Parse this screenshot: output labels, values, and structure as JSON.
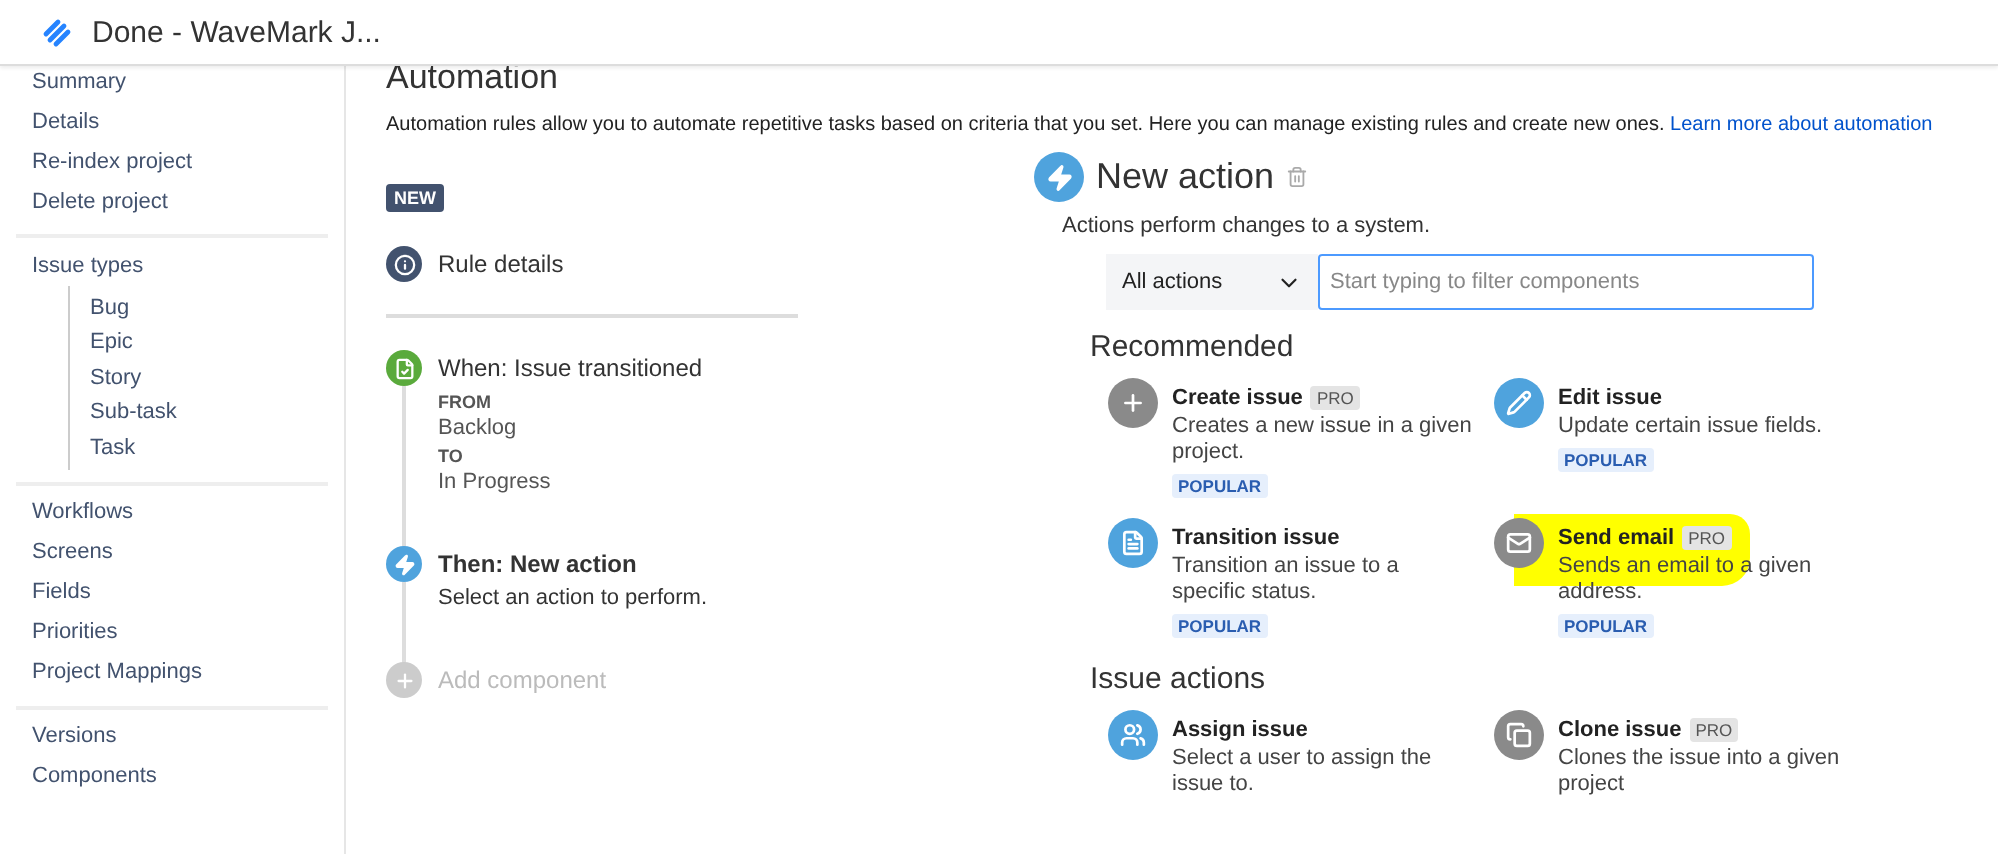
{
  "header": {
    "title": "Done - WaveMark J..."
  },
  "sidebar": {
    "groups": [
      {
        "items": [
          {
            "label": "Summary"
          },
          {
            "label": "Details"
          },
          {
            "label": "Re-index project"
          },
          {
            "label": "Delete project"
          }
        ]
      },
      {
        "items": [
          {
            "label": "Issue types",
            "children": [
              {
                "label": "Bug"
              },
              {
                "label": "Epic"
              },
              {
                "label": "Story"
              },
              {
                "label": "Sub-task"
              },
              {
                "label": "Task"
              }
            ]
          }
        ]
      },
      {
        "items": [
          {
            "label": "Workflows"
          },
          {
            "label": "Screens"
          },
          {
            "label": "Fields"
          },
          {
            "label": "Priorities"
          },
          {
            "label": "Project Mappings"
          }
        ]
      },
      {
        "items": [
          {
            "label": "Versions"
          },
          {
            "label": "Components"
          }
        ]
      }
    ]
  },
  "page": {
    "title": "Automation",
    "description": "Automation rules allow you to automate repetitive tasks based on criteria that you set. Here you can manage existing rules and create new ones.",
    "link": "Learn more about automation",
    "badge": "NEW"
  },
  "rule_steps": [
    {
      "kind": "details",
      "title": "Rule details",
      "selected": false
    },
    {
      "kind": "trigger",
      "title": "When: Issue transitioned",
      "selected": false,
      "fields": [
        {
          "label": "FROM",
          "value": "Backlog"
        },
        {
          "label": "TO",
          "value": "In Progress"
        }
      ]
    },
    {
      "kind": "action",
      "title": "Then: New action",
      "description": "Select an action to perform.",
      "selected": true
    },
    {
      "kind": "add",
      "title": "Add component",
      "selected": false
    }
  ],
  "panel": {
    "title": "New action",
    "description": "Actions perform changes to a system.",
    "filter": {
      "value": "All actions"
    },
    "search": {
      "placeholder": "Start typing to filter components"
    },
    "sections": [
      {
        "title": "Recommended",
        "components": [
          {
            "kind": "plus",
            "title": "Create issue",
            "pro": true,
            "pro_label": "PRO",
            "description": "Creates a new issue in a given project.",
            "popular": true,
            "popular_label": "POPULAR",
            "highlighted": false
          },
          {
            "kind": "pencil",
            "title": "Edit issue",
            "pro": false,
            "description": "Update certain issue fields.",
            "popular": true,
            "popular_label": "POPULAR",
            "highlighted": false
          },
          {
            "kind": "file",
            "title": "Transition issue",
            "pro": false,
            "description": "Transition an issue to a specific status.",
            "popular": true,
            "popular_label": "POPULAR",
            "highlighted": false
          },
          {
            "kind": "mail",
            "title": "Send email",
            "pro": true,
            "pro_label": "PRO",
            "description": "Sends an email to a given address.",
            "popular": true,
            "popular_label": "POPULAR",
            "highlighted": true
          }
        ]
      },
      {
        "title": "Issue actions",
        "components": [
          {
            "kind": "user",
            "title": "Assign issue",
            "pro": false,
            "description": "Select a user to assign the issue to.",
            "popular": false,
            "highlighted": false
          },
          {
            "kind": "copy",
            "title": "Clone issue",
            "pro": true,
            "pro_label": "PRO",
            "description": "Clones the issue into a given project",
            "popular": false,
            "highlighted": false
          }
        ]
      }
    ]
  }
}
